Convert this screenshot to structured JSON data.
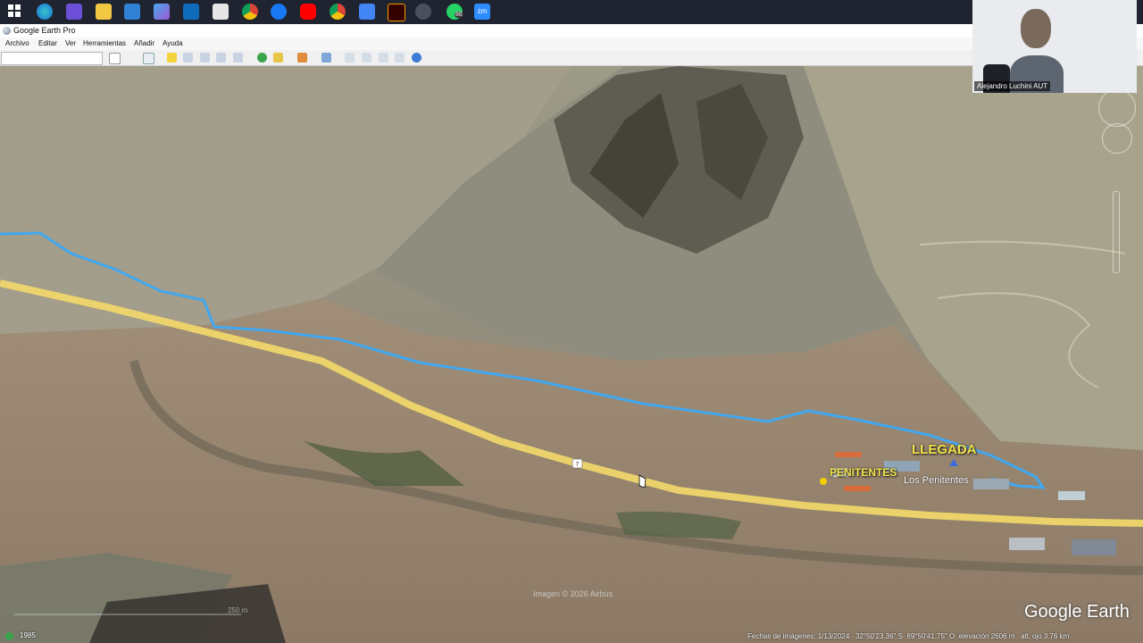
{
  "taskbar": {
    "icons": [
      "windows-start-icon",
      "edge-icon",
      "snipping-tool-icon",
      "file-explorer-icon",
      "microsoft-store-icon",
      "photos-icon",
      "outlook-icon",
      "mail-icon",
      "chrome-profile-icon",
      "facebook-icon",
      "youtube-icon",
      "chrome-icon",
      "google-docs-icon",
      "adobe-illustrator-icon",
      "google-earth-icon",
      "whatsapp-icon",
      "zoom-icon"
    ],
    "whatsapp_badge": "86",
    "zoom_label": "zm"
  },
  "window": {
    "title": "Google Earth Pro"
  },
  "menu": [
    "Archivo",
    "Editar",
    "Ver",
    "Herramientas",
    "Añadir",
    "Ayuda"
  ],
  "toolbar": {
    "search_placeholder": "",
    "tools": [
      "search-icon",
      "sidebar-toggle-icon",
      "placemark-icon",
      "polygon-icon",
      "path-icon",
      "overlay-icon",
      "tour-icon",
      "historical-imagery-icon",
      "sunlight-icon",
      "planets-icon",
      "ruler-icon",
      "email-icon",
      "print-icon",
      "save-image-icon",
      "maps-icon",
      "earth-icon"
    ]
  },
  "webcam": {
    "name": "Alejandro Luchini AUT"
  },
  "map": {
    "labels": {
      "llegada": "LLEGADA",
      "penitentes": "PENITENTES",
      "los_penitentes": "Los Penitentes",
      "route_marker": "7"
    },
    "imagery_credit": "Imagen © 2026 Airbus",
    "logo": "Google Earth",
    "scale_label": "250 m",
    "colors": {
      "route": "#41a8f0",
      "road": "#f2d86a",
      "label": "#f5e44a"
    }
  },
  "status": {
    "year": "1985",
    "imagery_date": "Fechas de imágenes: 1/13/2024",
    "lat": "32°50'23.36\" S",
    "lon": "69°50'41.75\" O",
    "elevation": "elevación  2606 m",
    "eye_alt": "alt. ojo  3.76 km"
  }
}
